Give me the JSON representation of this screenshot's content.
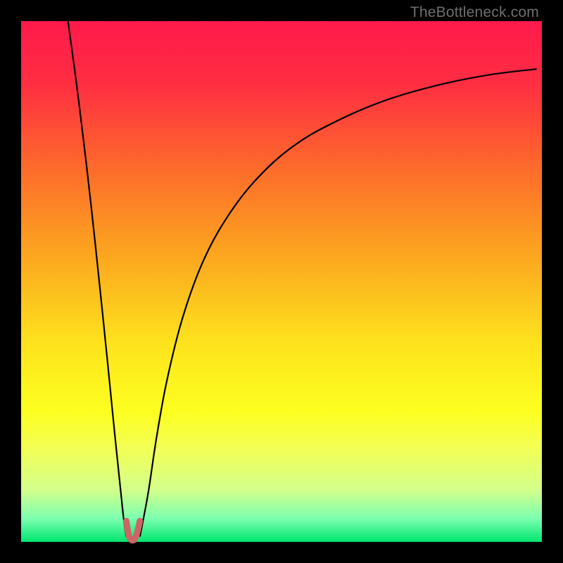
{
  "attribution": "TheBottleneck.com",
  "chart_data": {
    "type": "line",
    "title": "",
    "xlabel": "",
    "ylabel": "",
    "xlim": [
      0,
      100
    ],
    "ylim": [
      0,
      100
    ],
    "grid": false,
    "legend": false,
    "background_gradient": {
      "stops": [
        {
          "pos": 0.0,
          "color": "#ff1a4b"
        },
        {
          "pos": 0.12,
          "color": "#ff2e42"
        },
        {
          "pos": 0.28,
          "color": "#fd6a2b"
        },
        {
          "pos": 0.45,
          "color": "#fca61f"
        },
        {
          "pos": 0.62,
          "color": "#fde31d"
        },
        {
          "pos": 0.75,
          "color": "#fdff20"
        },
        {
          "pos": 0.82,
          "color": "#f3ff55"
        },
        {
          "pos": 0.9,
          "color": "#d3ff8b"
        },
        {
          "pos": 0.955,
          "color": "#7cffb0"
        },
        {
          "pos": 1.0,
          "color": "#00e66f"
        }
      ]
    },
    "series": [
      {
        "name": "left-branch",
        "color": "#000000",
        "x": [
          9.0,
          10.5,
          12.0,
          13.5,
          15.0,
          16.5,
          18.0,
          19.2,
          19.8,
          20.2
        ],
        "y": [
          100.0,
          89.0,
          77.0,
          64.0,
          50.0,
          35.5,
          20.5,
          9.0,
          3.5,
          1.0
        ]
      },
      {
        "name": "right-branch",
        "color": "#000000",
        "x": [
          22.8,
          23.4,
          24.5,
          26.0,
          28.0,
          31.0,
          35.0,
          40.0,
          46.0,
          53.0,
          61.0,
          70.0,
          80.0,
          90.0,
          99.0
        ],
        "y": [
          1.0,
          4.0,
          10.0,
          20.0,
          31.0,
          43.0,
          54.0,
          63.0,
          70.5,
          76.5,
          81.0,
          84.8,
          87.7,
          89.7,
          90.8
        ]
      },
      {
        "name": "valley-mark",
        "color": "#cc6666",
        "x": [
          20.2,
          20.7,
          21.4,
          22.1,
          22.8
        ],
        "y": [
          4.0,
          1.2,
          0.3,
          1.2,
          4.0
        ]
      }
    ]
  }
}
